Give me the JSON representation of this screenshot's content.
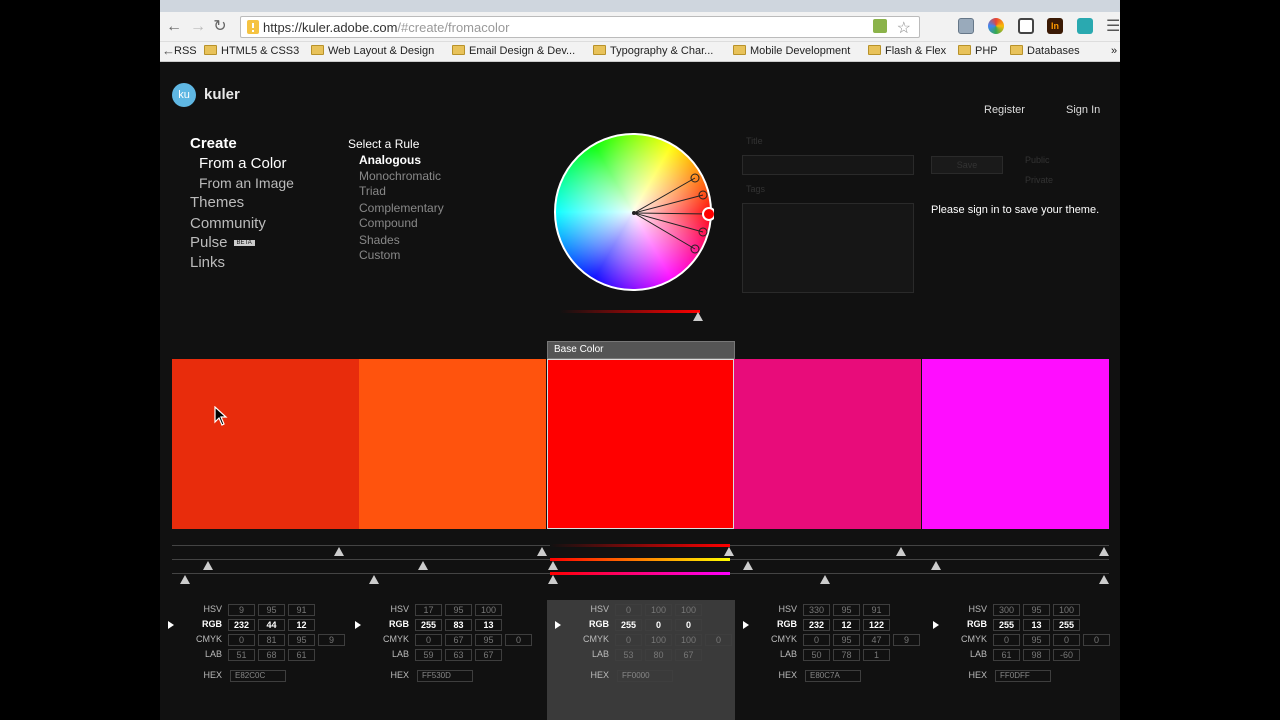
{
  "browser": {
    "url_host": "https://kuler.adobe.com",
    "url_path": "/#create/fromacolor",
    "bookmarks": [
      "RSS",
      "HTML5 & CSS3",
      "Web Layout & Design",
      "Email Design & Dev...",
      "Typography & Char...",
      "Mobile Development",
      "Flash & Flex",
      "PHP",
      "Databases"
    ]
  },
  "header": {
    "logo": "ku",
    "brand": "kuler",
    "register": "Register",
    "sign_in": "Sign In"
  },
  "nav": {
    "create": "Create",
    "from_color": "From a Color",
    "from_image": "From an Image",
    "themes": "Themes",
    "community": "Community",
    "pulse": "Pulse",
    "beta": "BETA",
    "links": "Links"
  },
  "rules": {
    "heading": "Select a Rule",
    "items": [
      "Analogous",
      "Monochromatic",
      "Triad",
      "Complementary",
      "Compound",
      "Shades",
      "Custom"
    ],
    "selected": "Analogous"
  },
  "save_form": {
    "title_label": "Title",
    "tags_label": "Tags",
    "save": "Save",
    "public": "Public",
    "private": "Private",
    "message": "Please sign in to save your theme."
  },
  "base_label": "Base Color",
  "swatches": [
    {
      "color": "#E82C0C",
      "hsv": [
        "9",
        "95",
        "91"
      ],
      "rgb": [
        "232",
        "44",
        "12"
      ],
      "cmyk": [
        "0",
        "81",
        "95",
        "9"
      ],
      "lab": [
        "51",
        "68",
        "61"
      ],
      "hex": "E82C0C"
    },
    {
      "color": "#FF530D",
      "hsv": [
        "17",
        "95",
        "100"
      ],
      "rgb": [
        "255",
        "83",
        "13"
      ],
      "cmyk": [
        "0",
        "67",
        "95",
        "0"
      ],
      "lab": [
        "59",
        "63",
        "67"
      ],
      "hex": "FF530D"
    },
    {
      "color": "#FF0000",
      "hsv": [
        "0",
        "100",
        "100"
      ],
      "rgb": [
        "255",
        "0",
        "0"
      ],
      "cmyk": [
        "0",
        "100",
        "100",
        "0"
      ],
      "lab": [
        "53",
        "80",
        "67"
      ],
      "hex": "FF0000"
    },
    {
      "color": "#E80C7A",
      "hsv": [
        "330",
        "95",
        "91"
      ],
      "rgb": [
        "232",
        "12",
        "122"
      ],
      "cmyk": [
        "0",
        "95",
        "47",
        "9"
      ],
      "lab": [
        "50",
        "78",
        "1"
      ],
      "hex": "E80C7A"
    },
    {
      "color": "#FF0DFF",
      "hsv": [
        "300",
        "95",
        "100"
      ],
      "rgb": [
        "255",
        "13",
        "255"
      ],
      "cmyk": [
        "0",
        "95",
        "0",
        "0"
      ],
      "lab": [
        "61",
        "98",
        "-60"
      ],
      "hex": "FF0DFF"
    }
  ],
  "value_labels": {
    "hsv": "HSV",
    "rgb": "RGB",
    "cmyk": "CMYK",
    "lab": "LAB",
    "hex": "HEX"
  }
}
